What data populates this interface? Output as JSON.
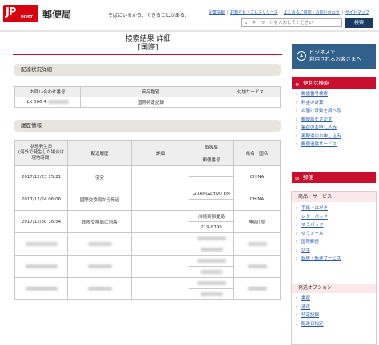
{
  "header": {
    "logo_glyph": "JP",
    "logo_sub": "POST",
    "brand": "郵便局",
    "tagline": "そばにいるから、できることがある。",
    "links": [
      "企業情報",
      "お知らせ・プレスリリース",
      "よくあるご質問・お問い合わせ",
      "サイトマップ"
    ],
    "search_placeholder": "キーワードを入力してください",
    "search_button": "検索"
  },
  "main": {
    "title_line1": "検索結果 詳細",
    "title_line2": "[国際]",
    "status_section": "配達状況詳細",
    "status_headers": [
      "お問い合わせ番号",
      "商品種別",
      "付加サービス"
    ],
    "status_row": {
      "tracking": "LX 066 4",
      "type": "国際特定記録",
      "extra": ""
    },
    "history_section": "履歴情報",
    "history_headers": {
      "date": "状態発生日\n(海外で発生した場合は現地時間)",
      "status": "配送履歴",
      "detail": "詳細",
      "office": "取扱局",
      "postal": "郵便番号",
      "region": "県名・国名"
    },
    "history_rows": [
      {
        "date": "2017/12/23 15:21",
        "status": "引受",
        "detail": "",
        "office": "",
        "postal": "",
        "region": "CHINA"
      },
      {
        "date": "2017/12/24 06:06",
        "status": "国際交換局から発送",
        "detail": "",
        "office": "GUANGZHOU EM",
        "postal": "",
        "region": "CHINA"
      },
      {
        "date": "2017/12/30 16:54",
        "status": "国際交換局に到着",
        "detail": "",
        "office": "川崎東郵便局",
        "postal": "219-8799",
        "region": "神奈川県"
      }
    ]
  },
  "sidebar": {
    "business_button": "ビジネスで\n利用されるお客さまへ",
    "useful_head": "便利な機能",
    "useful_items": [
      "郵便番号検索",
      "料金の計算",
      "お届け日数を調べる",
      "郵便局をさがす",
      "集荷のお申し込み",
      "再配達のお申し込み",
      "郵便追跡サービス"
    ],
    "mail_head": "郵便",
    "services_head": "商品・サービス",
    "services_items": [
      "手紙・はがき",
      "レターパック",
      "ゆうパック",
      "ゆうメール",
      "国際郵便",
      "切手",
      "転居・転送サービス"
    ],
    "options_head": "発送オプション",
    "options_items": [
      "書留",
      "速達",
      "特定記録",
      "配達日指定"
    ]
  }
}
